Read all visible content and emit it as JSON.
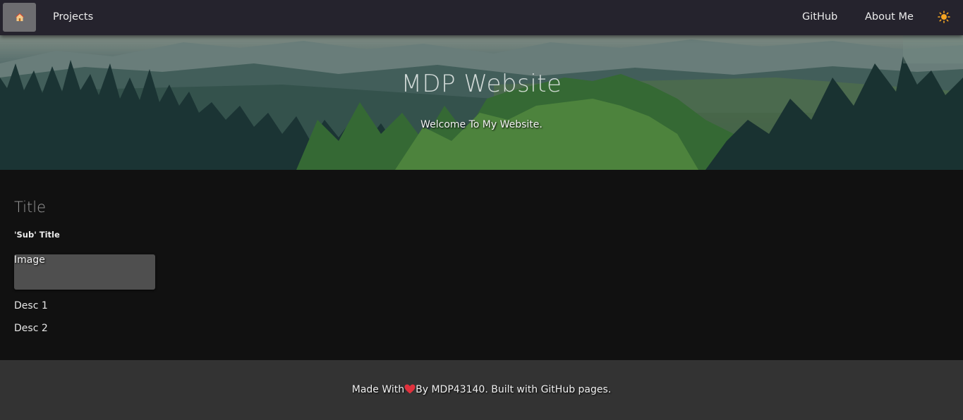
{
  "nav": {
    "home_icon": "house-icon",
    "projects": "Projects",
    "github": "GitHub",
    "about": "About Me",
    "theme_icon": "sun-icon"
  },
  "hero": {
    "title": "MDP Website",
    "subtitle": "Welcome To My Website."
  },
  "content": {
    "title": "Title",
    "subtitle": "'Sub' Title",
    "image_label": "Image",
    "desc1": "Desc 1",
    "desc2": "Desc 2"
  },
  "footer": {
    "made_with": "Made With",
    "by": "By MDP43140. Built with GitHub pages.",
    "heart_icon": "heart-icon"
  },
  "colors": {
    "navbar": "#25232d",
    "content_bg": "#111111",
    "footer_bg": "#333333",
    "heart": "#e0313d",
    "sun": "#f5a623"
  }
}
